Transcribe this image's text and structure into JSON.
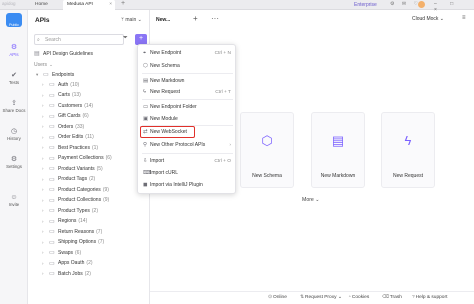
{
  "titlebar": {
    "logo": "apidog",
    "home": "Home",
    "tab": "Medusa API",
    "tab_close": "×",
    "new_tab": "+",
    "enterprise": "Enterprise",
    "icons": "⚙ ✉ ♡",
    "user": "",
    "window_controls": "– □ ×"
  },
  "rail": {
    "logo_label": "Public",
    "items": [
      {
        "label": "APIs",
        "icon": "api-icon",
        "glyph": "⚙"
      },
      {
        "label": "Tests",
        "icon": "tests-icon",
        "glyph": "✔"
      },
      {
        "label": "Share Docs",
        "icon": "share-docs-icon",
        "glyph": "⇪"
      },
      {
        "label": "History",
        "icon": "history-icon",
        "glyph": "◷"
      },
      {
        "label": "Settings",
        "icon": "settings-icon",
        "glyph": "⚙"
      },
      {
        "label": "Invite",
        "icon": "invite-icon",
        "glyph": "☺"
      }
    ]
  },
  "sidebar": {
    "title": "APIs",
    "search_placeholder": "Search",
    "guidelines": "API Design Guidelines",
    "users": "Users",
    "endpoints": "Endpoints",
    "folders": [
      {
        "name": "Auth",
        "count": "(10)"
      },
      {
        "name": "Carts",
        "count": "(13)"
      },
      {
        "name": "Customers",
        "count": "(14)"
      },
      {
        "name": "Gift Cards",
        "count": "(6)"
      },
      {
        "name": "Orders",
        "count": "(33)"
      },
      {
        "name": "Order Edits",
        "count": "(11)"
      },
      {
        "name": "Best Practices",
        "count": "(1)"
      },
      {
        "name": "Payment Collections",
        "count": "(6)"
      },
      {
        "name": "Product Variants",
        "count": "(5)"
      },
      {
        "name": "Product Tags",
        "count": "(2)"
      },
      {
        "name": "Product Categories",
        "count": "(9)"
      },
      {
        "name": "Product Collections",
        "count": "(9)"
      },
      {
        "name": "Product Types",
        "count": "(2)"
      },
      {
        "name": "Regions",
        "count": "(14)"
      },
      {
        "name": "Return Reasons",
        "count": "(7)"
      },
      {
        "name": "Shipping Options",
        "count": "(7)"
      },
      {
        "name": "Swaps",
        "count": "(6)"
      },
      {
        "name": "Apps Oauth",
        "count": "(2)"
      },
      {
        "name": "Batch Jobs",
        "count": "(2)"
      }
    ]
  },
  "main": {
    "env": "main",
    "tab_label": "New...",
    "plus": "+",
    "more": "···",
    "env_selector": "Cloud Mock",
    "menu_icon": "≡",
    "cards": [
      {
        "label": "New Schema",
        "icon": "schema-icon",
        "glyph": "⬡"
      },
      {
        "label": "New Markdown",
        "icon": "markdown-icon",
        "glyph": "▤"
      },
      {
        "label": "New Request",
        "icon": "request-icon",
        "glyph": "ϟ"
      }
    ],
    "more_button": "More ⌄"
  },
  "menu": {
    "items": [
      {
        "label": "New Endpoint",
        "shortcut": "Ctrl + N",
        "icon": "endpoint-icon",
        "glyph": "⌖"
      },
      {
        "label": "New Schema",
        "shortcut": "",
        "icon": "schema-icon",
        "glyph": "⬡"
      },
      {
        "label": "New Markdown",
        "shortcut": "",
        "icon": "markdown-icon",
        "glyph": "▤"
      },
      {
        "label": "New Request",
        "shortcut": "Ctrl + T",
        "icon": "request-icon",
        "glyph": "ϟ"
      },
      {
        "label": "New Endpoint Folder",
        "shortcut": "",
        "icon": "folder-icon",
        "glyph": "▭"
      },
      {
        "label": "New Module",
        "shortcut": "",
        "icon": "module-icon",
        "glyph": "▣"
      },
      {
        "label": "New WebSocket",
        "shortcut": "",
        "icon": "websocket-icon",
        "glyph": "⇄"
      },
      {
        "label": "New Other Protocol APIs",
        "shortcut": "›",
        "icon": "protocol-icon",
        "glyph": "⚲"
      },
      {
        "label": "Import",
        "shortcut": "Ctrl + O",
        "icon": "import-icon",
        "glyph": "⇩"
      },
      {
        "label": "Import cURL",
        "shortcut": "",
        "icon": "curl-icon",
        "glyph": "⌨"
      },
      {
        "label": "Import via IntelliJ Plugin",
        "shortcut": "",
        "icon": "intellij-icon",
        "glyph": "◼"
      }
    ]
  },
  "statusbar": {
    "online": "Online",
    "proxy": "Request Proxy ⌄",
    "cookies": "Cookies",
    "trash": "Trash",
    "help": "Help & support"
  }
}
